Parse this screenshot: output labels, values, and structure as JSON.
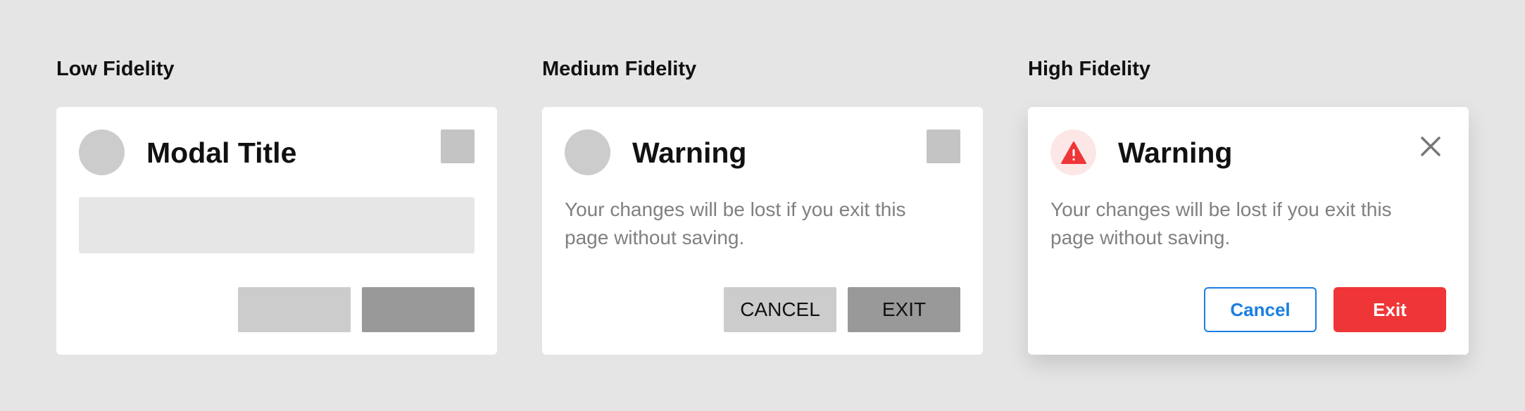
{
  "columns": {
    "low": {
      "label": "Low Fidelity",
      "title": "Modal Title"
    },
    "medium": {
      "label": "Medium Fidelity",
      "title": "Warning",
      "body": "Your changes will be lost if you exit this page without saving.",
      "cancel_label": "CANCEL",
      "exit_label": "EXIT"
    },
    "high": {
      "label": "High Fidelity",
      "title": "Warning",
      "body": "Your changes will be lost if you exit this page without saving.",
      "cancel_label": "Cancel",
      "exit_label": "Exit"
    }
  },
  "icons": {
    "warning": "warning-triangle-icon",
    "close": "close-icon"
  },
  "colors": {
    "background": "#e5e5e5",
    "primary_blue": "#1a7fe0",
    "danger_red": "#ef3537",
    "warning_tint": "#fde6e6",
    "placeholder_light": "#cccccc",
    "placeholder_dark": "#999999"
  }
}
